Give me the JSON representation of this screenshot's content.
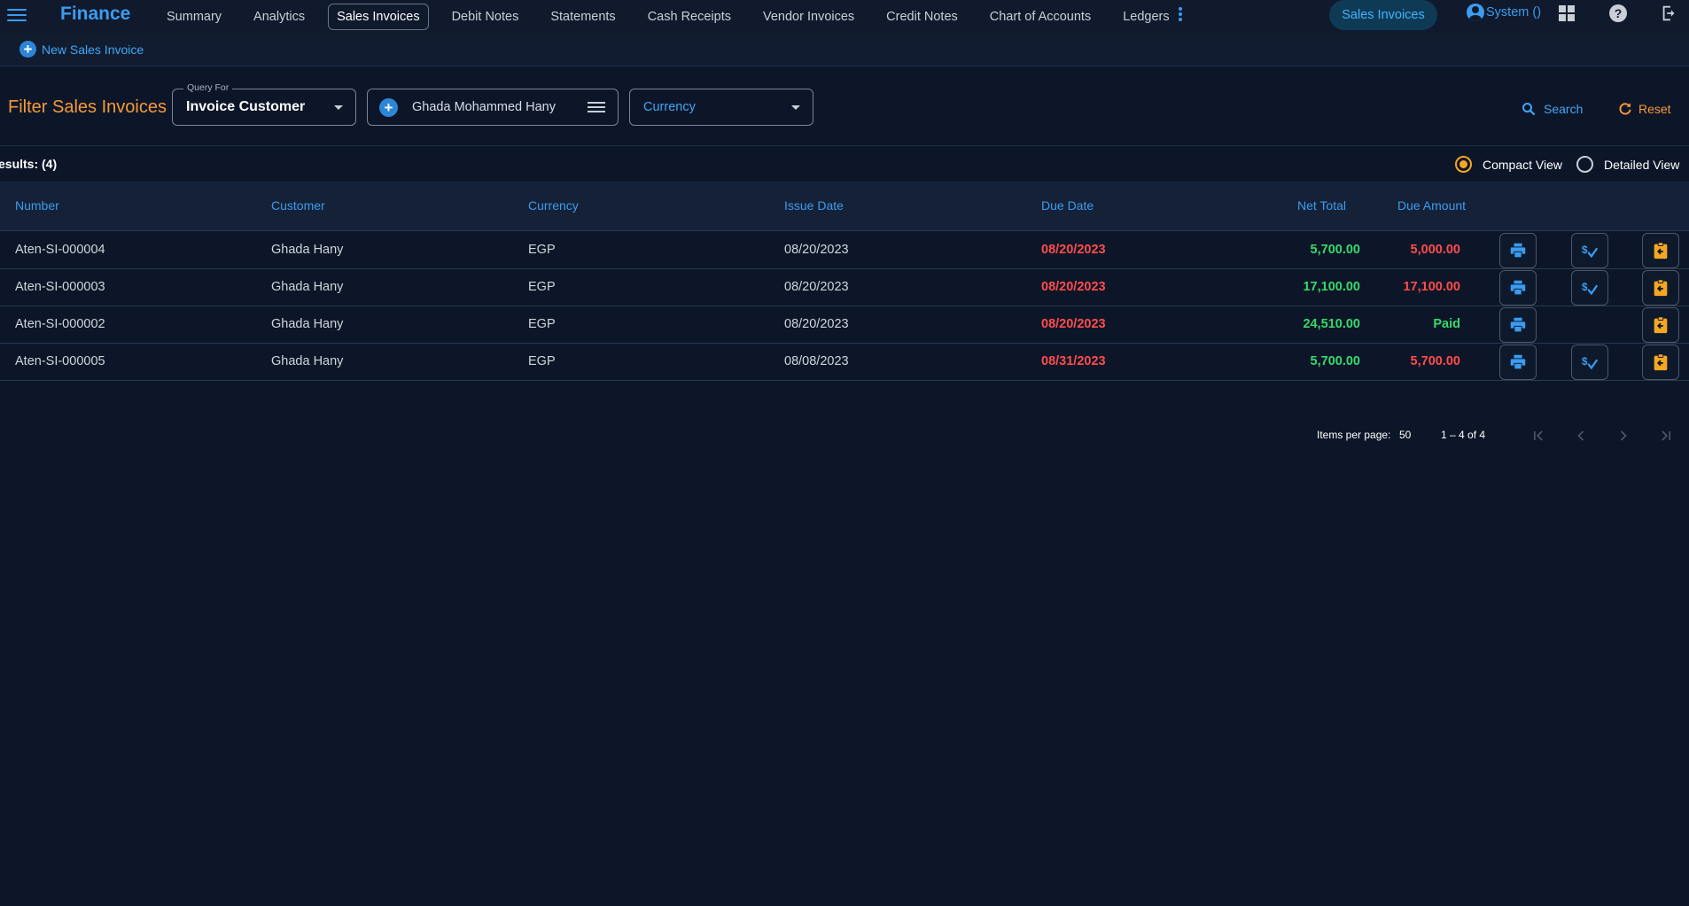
{
  "app": {
    "brand": "Finance"
  },
  "nav": {
    "items": [
      "Summary",
      "Analytics",
      "Sales Invoices",
      "Debit Notes",
      "Statements",
      "Cash Receipts",
      "Vendor Invoices",
      "Credit Notes",
      "Chart of Accounts",
      "Ledgers"
    ],
    "active": "Sales Invoices",
    "pill": "Sales Invoices",
    "user": "System ()"
  },
  "toolbar": {
    "new_label": "New Sales Invoice"
  },
  "filter": {
    "title": "Filter Sales Invoices",
    "query_legend": "Query For",
    "query_value": "Invoice Customer",
    "customer_value": "Ghada Mohammed Hany",
    "currency_placeholder": "Currency",
    "search_label": "Search",
    "reset_label": "Reset"
  },
  "results": {
    "label": "esults: (4)",
    "views": [
      "Compact View",
      "Detailed View"
    ],
    "selected_view": "Compact View"
  },
  "table": {
    "columns": [
      "Number",
      "Customer",
      "Currency",
      "Issue Date",
      "Due Date",
      "Net Total",
      "Due Amount"
    ],
    "rows": [
      {
        "number": "Aten-SI-000004",
        "customer": "Ghada Hany",
        "currency": "EGP",
        "issue_date": "08/20/2023",
        "due_date": "08/20/2023",
        "net_total": "5,700.00",
        "due_amount": "5,000.00",
        "has_pay": true
      },
      {
        "number": "Aten-SI-000003",
        "customer": "Ghada Hany",
        "currency": "EGP",
        "issue_date": "08/20/2023",
        "due_date": "08/20/2023",
        "net_total": "17,100.00",
        "due_amount": "17,100.00",
        "has_pay": true
      },
      {
        "number": "Aten-SI-000002",
        "customer": "Ghada Hany",
        "currency": "EGP",
        "issue_date": "08/20/2023",
        "due_date": "08/20/2023",
        "net_total": "24,510.00",
        "due_amount": "Paid",
        "has_pay": false
      },
      {
        "number": "Aten-SI-000005",
        "customer": "Ghada Hany",
        "currency": "EGP",
        "issue_date": "08/08/2023",
        "due_date": "08/31/2023",
        "net_total": "5,700.00",
        "due_amount": "5,700.00",
        "has_pay": true
      }
    ]
  },
  "paginator": {
    "items_per_page_label": "Items per page:",
    "items_per_page": "50",
    "range": "1 – 4 of 4"
  },
  "colors": {
    "background": "#0d1628",
    "accent": "#3b9cf0",
    "orange": "#f59a3a",
    "overdue": "#ff4c4c",
    "positive": "#38d96a"
  },
  "icons": [
    "menu-icon",
    "more-vert-icon",
    "account-icon",
    "dashboard-icon",
    "help-icon",
    "logout-icon",
    "add-circle-icon",
    "list-icon",
    "search-icon",
    "reset-icon",
    "print-icon",
    "payment-icon",
    "clipboard-icon",
    "first-page-icon",
    "prev-page-icon",
    "next-page-icon",
    "last-page-icon"
  ]
}
